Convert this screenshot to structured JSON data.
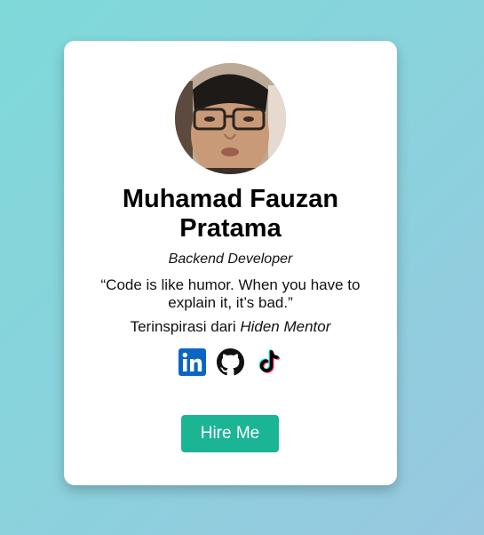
{
  "profile": {
    "avatar_alt": "Profile photo",
    "name": "Muhamad Fauzan Pratama",
    "role": "Backend Developer",
    "quote": "“Code is like humor. When you have to explain it, it’s bad.”",
    "inspiration_prefix": "Terinspirasi dari ",
    "inspiration_source": "Hiden Mentor"
  },
  "socials": [
    {
      "icon": "linkedin-icon",
      "color": "#0a66c2"
    },
    {
      "icon": "github-icon",
      "color": "#111111"
    },
    {
      "icon": "tiktok-icon",
      "color": "#000000"
    }
  ],
  "cta": {
    "label": "Hire Me",
    "color": "#1bb494"
  }
}
